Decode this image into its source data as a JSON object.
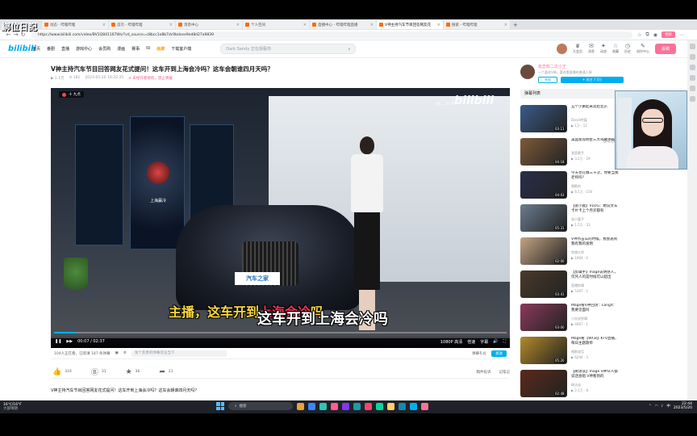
{
  "overlay": {
    "watermark": "綁位日記"
  },
  "browser": {
    "tabs": [
      {
        "label": "动态 · 哔哩哔哩",
        "active": false
      },
      {
        "label": "首页 - 哔哩哔哩",
        "active": false
      },
      {
        "label": "消息中心",
        "active": false
      },
      {
        "label": "个人空间",
        "active": false
      },
      {
        "label": "直播中心 - 哔哩哔哩直播",
        "active": false
      },
      {
        "label": "V神主持汽车节目回答网友花",
        "active": true
      },
      {
        "label": "搜索 - 哔哩哔哩",
        "active": false
      }
    ],
    "url": "https://www.bilibili.com/video/BV1Q841167Ws/?vd_source=c8bcc1e8b7dc9bdcee9ed8d27a9839",
    "right_button": "更新"
  },
  "header": {
    "logo": "bilibili",
    "nav": [
      {
        "label": "首页",
        "highlight": false
      },
      {
        "label": "番剧",
        "highlight": false
      },
      {
        "label": "直播",
        "highlight": false
      },
      {
        "label": "游戏中心",
        "highlight": false
      },
      {
        "label": "会员购",
        "highlight": false
      },
      {
        "label": "漫画",
        "highlight": false
      },
      {
        "label": "赛事",
        "highlight": false
      },
      {
        "label": "IU",
        "highlight": false
      },
      {
        "label": "画廊",
        "highlight": true
      },
      {
        "label": "下载客户端",
        "highlight": false
      }
    ],
    "search_placeholder": "Dark Sandy 正在观看你",
    "right_items": [
      "大会员",
      "消息",
      "动态",
      "收藏",
      "历史",
      "创作中心"
    ],
    "upload_label": "投稿"
  },
  "video": {
    "title": "V神主持汽车节目回答网友花式提问！这车开到上海会冷吗？这车会朝谁四月天吗？",
    "meta": {
      "views": "1.1万",
      "danmaku": "181",
      "date": "2023-05-20 19:32:25",
      "warning": "未经作者授权，禁止转载"
    },
    "player": {
      "live_badge": "十 九点",
      "watermark_user": "@二小王",
      "watermark_logo": "bilibili",
      "plate_text": "汽车之家",
      "screen_name": "上海赢冷",
      "subtitle": {
        "part1": "主播，这车开到",
        "part2": "上海会冷",
        "part3": "吗"
      },
      "progress": 0.05,
      "time": "00:07 / 02:37",
      "controls": [
        "1080P 高清",
        "倍速",
        "字幕"
      ]
    },
    "danmaku_bar": {
      "watching": "104人正在看，已装填 187 条弹幕",
      "input_placeholder": "发个友善的弹幕见证当下",
      "etiquette": "弹幕礼仪",
      "send": "发送"
    },
    "overlay_subtitle": "这车开到上海会冷吗",
    "toolbar": {
      "like": "324",
      "coin": "31",
      "favorite": "36",
      "share": "21",
      "right": [
        "稿件投诉",
        "记笔记"
      ]
    },
    "description": "V神主持汽车节目回答网友花式提问！这车开到上海会冷吗？这车会朝谁四月天吗？"
  },
  "sidebar": {
    "up": {
      "name": "有恋软二次小王",
      "desc": "一个喜欢V神，喜欢看直播的普通人呀",
      "charge": "充电",
      "follow": "+ 关注 7.5万"
    },
    "danmaku_list": "弹幕列表",
    "recommend_header": "接下来播放",
    "autoplay": "自动连播",
    "recommendations": [
      {
        "title": "五个小舅起来奔赴北京",
        "author": "Dandi传媒",
        "stats": "▶ 1万 · 12",
        "dur": "03:11",
        "color": "#3b5b8a"
      },
      {
        "title": "美国发现明星三大哥歌手呢",
        "author": "我是歌手",
        "stats": "▶ 3.2万 · 29",
        "dur": "04:18",
        "color": "#7e5a3a"
      },
      {
        "title": "今天也在做三千次，你要当我老师吗？",
        "author": "唱歌的",
        "stats": "▶ 6.1万 · 104",
        "dur": "04:03",
        "color": "#2a2f4a"
      },
      {
        "title": "【张小鹿】VLOG：她说文车卡片卡上个月买都有",
        "author": "张小鹿子",
        "stats": "▶ 1.5万 · 33",
        "dur": "05:31",
        "color": "#6b7d8e"
      },
      {
        "title": "V神点击车的时候，我会遇到我有我的发明",
        "author": "剪辑大师",
        "stats": "▶ 1904 · 0",
        "dur": "02:00",
        "color": "#c4a484"
      },
      {
        "title": "【剪辑手】mage说明感人，仅凭人的是时候可以超出",
        "author": "直播剪辑",
        "stats": "▶ 5397 · 2",
        "dur": "03:41",
        "color": "#4a3a2a"
      },
      {
        "title": "Mage看V神回访：LangX：我要见面吗",
        "author": "小灰说剪辑",
        "stats": "▶ 4467 · 1",
        "dur": "03:00",
        "color": "#8a3a5a"
      },
      {
        "title": "Mage看【WCB】KTV直播，每日主题歌单",
        "author": "唱歌说话",
        "stats": "▶ 6294 · 3",
        "dur": "05:20",
        "color": "#b38a2a"
      },
      {
        "title": "【刷访谈】mage V神众人都说话会唱 V神看到的",
        "author": "刷访谈",
        "stats": "▶ 2.1万 · 8",
        "dur": "02:48",
        "color": "#5a2a1a"
      }
    ]
  },
  "taskbar": {
    "weather_temp": "16℃/16°F",
    "weather_desc": "大部晴朗",
    "search_label": "搜索",
    "time": "22:44",
    "date": "2023/5/20",
    "lang": "中",
    "app_colors": [
      "#e8a33d",
      "#3a86ff",
      "#2ec4b6",
      "#ff5d8f",
      "#8338ec",
      "#1b9aaa",
      "#ef476f",
      "#06d6a0",
      "#ffd166",
      "#118ab2",
      "#00aeec",
      "#fb7299"
    ]
  }
}
